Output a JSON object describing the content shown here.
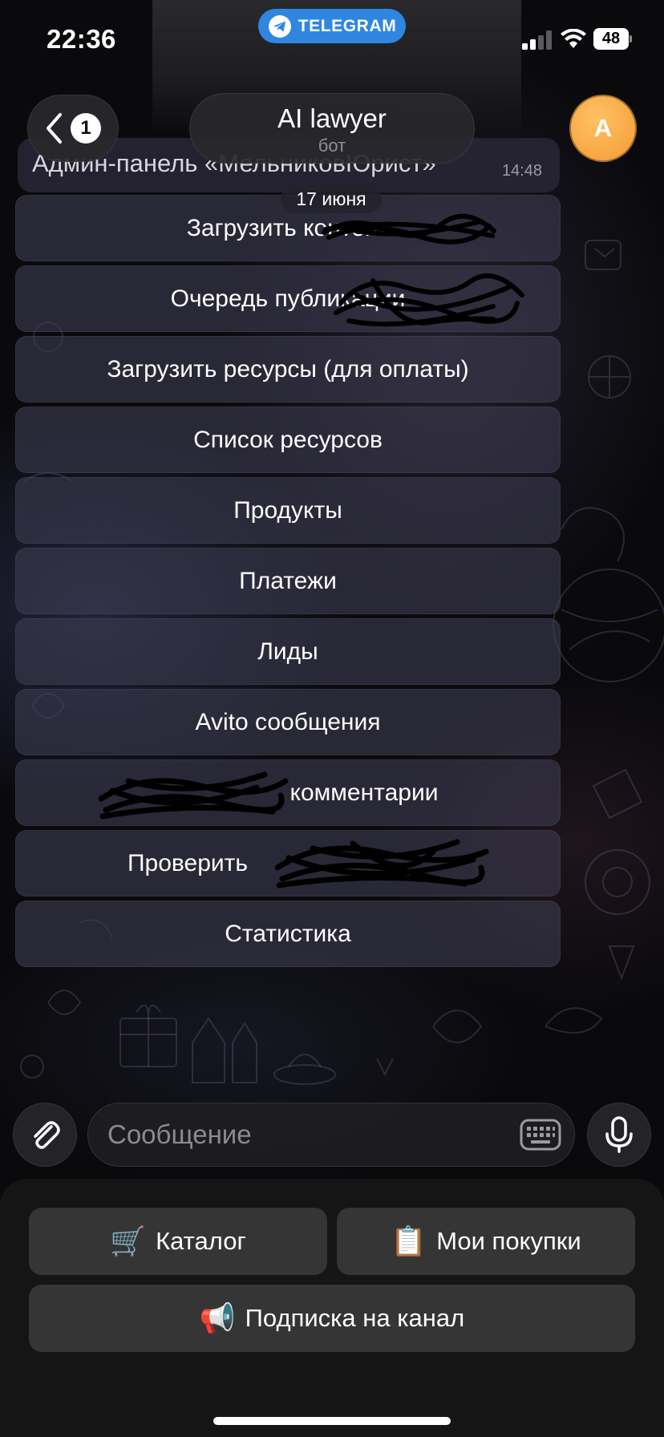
{
  "status_bar": {
    "time": "22:36",
    "source_app": "TELEGRAM",
    "battery_level": "48"
  },
  "nav": {
    "back_badge": "1",
    "title": "AI lawyer",
    "subtitle": "бот",
    "avatar_letter": "A"
  },
  "peek_message": {
    "text": "Админ-панель «МельниковЮрист»",
    "time": "14:48"
  },
  "date_chip": "17 июня",
  "inline_keyboard": [
    {
      "label": "Загрузить контент"
    },
    {
      "label": "Очередь публикации"
    },
    {
      "label": "Загрузить ресурсы (для оплаты)"
    },
    {
      "label": "Список ресурсов"
    },
    {
      "label": "Продукты"
    },
    {
      "label": "Платежи"
    },
    {
      "label": "Лиды"
    },
    {
      "label": "Avito сообщения"
    },
    {
      "label": "комментарии"
    },
    {
      "label": "Проверить"
    },
    {
      "label": "Статистика"
    }
  ],
  "input": {
    "placeholder": "Сообщение"
  },
  "reply_keyboard": [
    {
      "emoji": "🛒",
      "label": "Каталог"
    },
    {
      "emoji": "📋",
      "label": "Мои покупки"
    },
    {
      "emoji": "📢",
      "label": "Подписка на канал"
    }
  ],
  "colors": {
    "accent_blue": "#2f86e0",
    "avatar_orange": "#f59b35",
    "button_bg": "#353536"
  }
}
